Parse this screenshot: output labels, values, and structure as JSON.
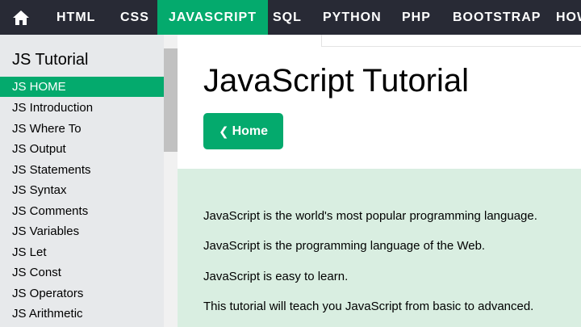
{
  "nav": {
    "items": [
      {
        "label": "HTML"
      },
      {
        "label": "CSS"
      },
      {
        "label": "JAVASCRIPT",
        "active": true
      },
      {
        "label": "SQL"
      },
      {
        "label": "PYTHON"
      },
      {
        "label": "PHP"
      },
      {
        "label": "BOOTSTRAP"
      },
      {
        "label": "HOW"
      }
    ],
    "home_icon": "home-icon",
    "active_color": "#04aa6d",
    "bar_color": "#282a35"
  },
  "sidebar": {
    "title": "JS Tutorial",
    "links": [
      {
        "label": "JS HOME",
        "active": true
      },
      {
        "label": "JS Introduction"
      },
      {
        "label": "JS Where To"
      },
      {
        "label": "JS Output"
      },
      {
        "label": "JS Statements"
      },
      {
        "label": "JS Syntax"
      },
      {
        "label": "JS Comments"
      },
      {
        "label": "JS Variables"
      },
      {
        "label": "JS Let"
      },
      {
        "label": "JS Const"
      },
      {
        "label": "JS Operators"
      },
      {
        "label": "JS Arithmetic"
      }
    ]
  },
  "main": {
    "title": "JavaScript Tutorial",
    "home_button": "Home",
    "paragraphs": [
      "JavaScript is the world's most popular programming language.",
      "JavaScript is the programming language of the Web.",
      "JavaScript is easy to learn.",
      "This tutorial will teach you JavaScript from basic to advanced."
    ],
    "panel_color": "#d9eee1"
  }
}
